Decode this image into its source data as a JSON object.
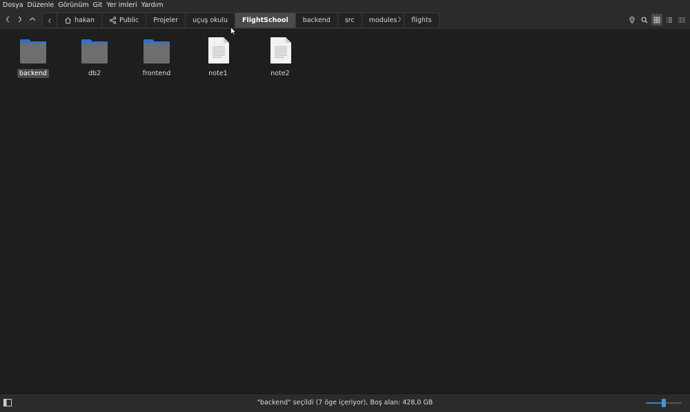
{
  "menubar": {
    "items": [
      "Dosya",
      "Düzenle",
      "Görünüm",
      "Git",
      "Yer imleri",
      "Yardım"
    ]
  },
  "breadcrumb": {
    "home_label": "hakan",
    "items": [
      "Public",
      "Projeler",
      "uçuş okulu",
      "FlightSchool",
      "backend",
      "src",
      "modules",
      "flights"
    ],
    "active": "FlightSchool"
  },
  "files": [
    {
      "name": "backend",
      "type": "folder",
      "selected": true
    },
    {
      "name": "db2",
      "type": "folder",
      "selected": false
    },
    {
      "name": "frontend",
      "type": "folder",
      "selected": false
    },
    {
      "name": "note1",
      "type": "text-file",
      "selected": false
    },
    {
      "name": "note2",
      "type": "text-file",
      "selected": false
    }
  ],
  "statusbar": {
    "text": "\"backend\" seçildi (7 öge içeriyor), Boş alan: 428,0 GB",
    "zoom_level": 0.5
  },
  "view_mode": "icon-grid",
  "colors": {
    "folder_tab": "#2f6fd0",
    "folder_body": "#6e6e6e",
    "accent": "#4a90d9"
  }
}
